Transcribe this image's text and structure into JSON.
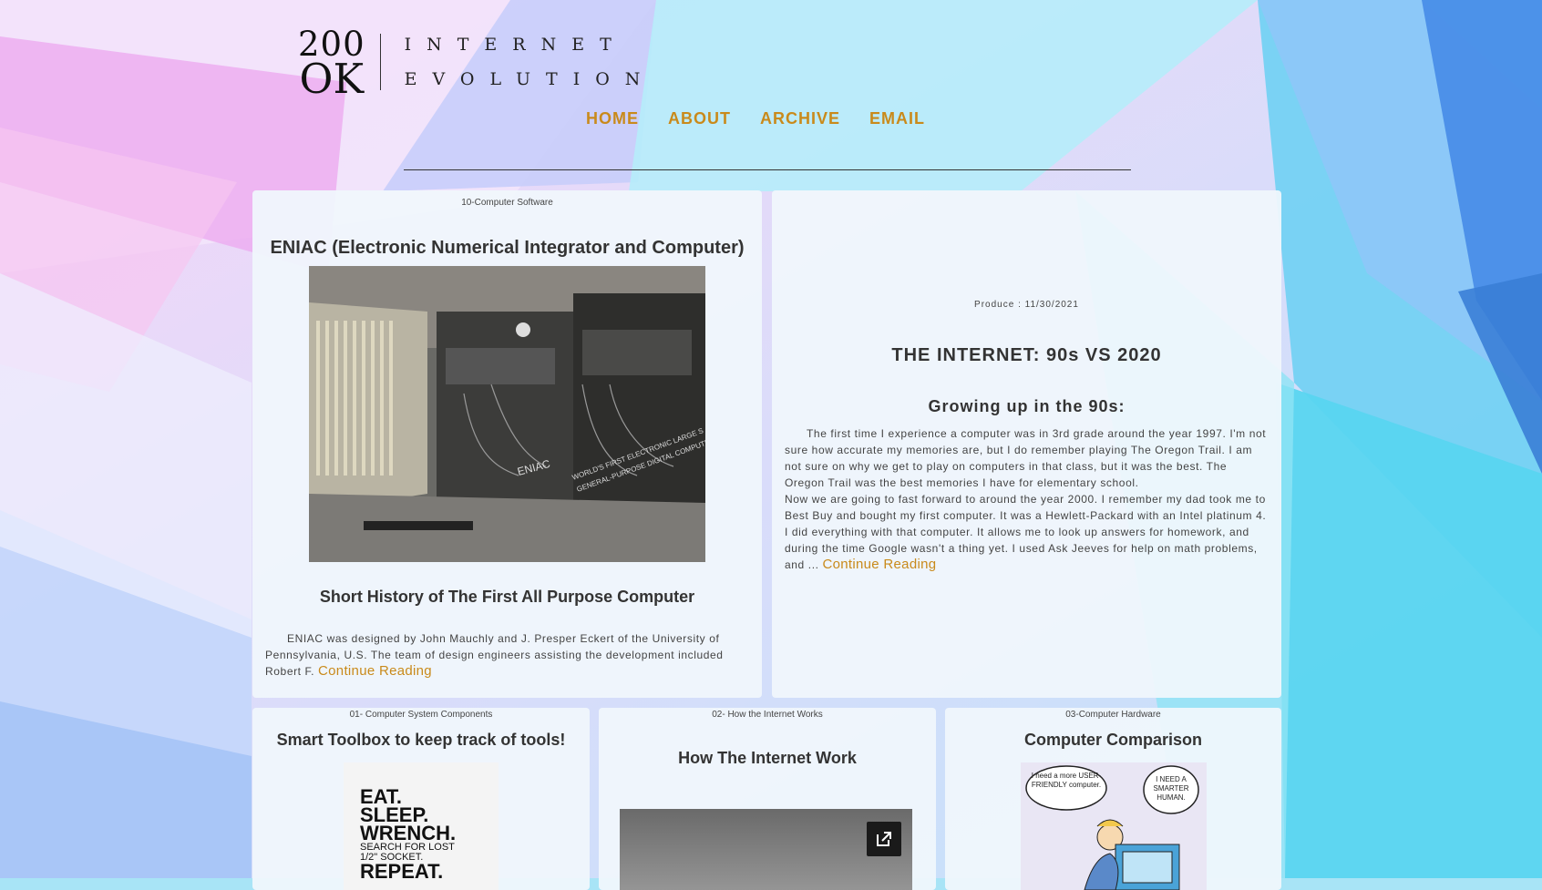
{
  "logo": {
    "line1": "200",
    "line2": "OK",
    "word1": "INTERNET",
    "word2": "EVOLUTION"
  },
  "nav": [
    {
      "label": "HOME"
    },
    {
      "label": "ABOUT"
    },
    {
      "label": "ARCHIVE"
    },
    {
      "label": "EMAIL"
    }
  ],
  "colors": {
    "accent": "#c98a1b",
    "card_bg": "#f0f7fc"
  },
  "post_eniac": {
    "category": "10-Computer Software",
    "title": "ENIAC (Electronic Numerical Integrator and Computer)",
    "image_text_1": "ENIAC",
    "image_text_2": "WORLD'S FIRST ELECTRONIC LARGE S",
    "image_text_3": "GENERAL-PURPOSE DIGITAL COMPUTER",
    "subtitle": "Short History of The First All Purpose Computer",
    "excerpt": "ENIAC was designed by John Mauchly and J. Presper Eckert of the University of Pennsylvania, U.S. The team of design engineers assisting the development included Robert F.",
    "continue": "Continue Reading"
  },
  "post_internet": {
    "meta": "Produce : 11/30/2021",
    "title": "THE INTERNET: 90s VS 2020",
    "subtitle": "Growing up in the 90s:",
    "para1": "The first time I experience a computer was in 3rd grade around the year 1997. I'm not sure how accurate my memories are, but I do remember playing The Oregon Trail. I am not sure on why we get to play on computers in that class, but it was the best. The Oregon Trail was the best memories I have for elementary school.",
    "para2": "Now we are going to fast forward to around the year 2000. I remember my dad took me to Best Buy and bought my first computer. It was a Hewlett-Packard with an Intel platinum 4. I did everything with that computer. It allows me to look up answers for homework, and during the time Google wasn't a thing yet. I used Ask Jeeves for help on math problems, and ...",
    "continue": "Continue Reading"
  },
  "post_toolbox": {
    "category": "01- Computer System Components",
    "title": "Smart Toolbox to keep track of tools!",
    "image_lines": [
      "EAT.",
      "SLEEP.",
      "WRENCH.",
      "SEARCH FOR LOST",
      "1/2\" SOCKET.",
      "REPEAT."
    ]
  },
  "post_howinternet": {
    "category": "02- How the Internet Works",
    "title": "How The Internet Work",
    "external_icon": "external-link-icon"
  },
  "post_comparison": {
    "category": "03-Computer Hardware",
    "title": "Computer Comparison",
    "bubble1": "I need a more USER-FRIENDLY computer.",
    "bubble2": "I NEED A SMARTER HUMAN."
  }
}
